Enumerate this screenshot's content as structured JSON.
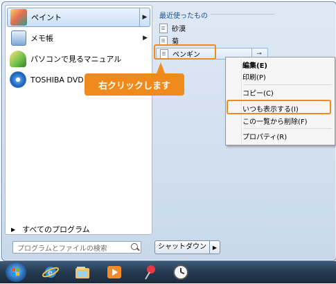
{
  "left_pane": {
    "items": [
      {
        "label": "ペイント",
        "icon": "paint-icon"
      },
      {
        "label": "メモ帳",
        "icon": "notepad-icon"
      },
      {
        "label": "パソコンで見るマニュアル",
        "icon": "manual-icon"
      },
      {
        "label": "TOSHIBA DVD PLA",
        "icon": "dvd-player-icon"
      }
    ],
    "all_programs": "すべてのプログラム"
  },
  "jump_list": {
    "header": "最近使ったもの",
    "items": [
      "砂漠",
      "菊",
      "ペンギン"
    ]
  },
  "callout": "右クリックします",
  "context_menu": {
    "items": [
      "編集(E)",
      "印刷(P)",
      "コピー(C)",
      "いつも表示する(I)",
      "この一覧から削除(F)",
      "プロパティ(R)"
    ]
  },
  "search": {
    "placeholder": "プログラムとファイルの検索"
  },
  "shutdown": {
    "label": "シャットダウン"
  },
  "taskbar": {
    "icons": [
      "start-orb-icon",
      "internet-explorer-icon",
      "explorer-icon",
      "media-player-icon",
      "pin-icon",
      "clock-icon"
    ]
  },
  "colors": {
    "highlight": "#f08a1c",
    "menu_text": "#1b4f8d"
  }
}
